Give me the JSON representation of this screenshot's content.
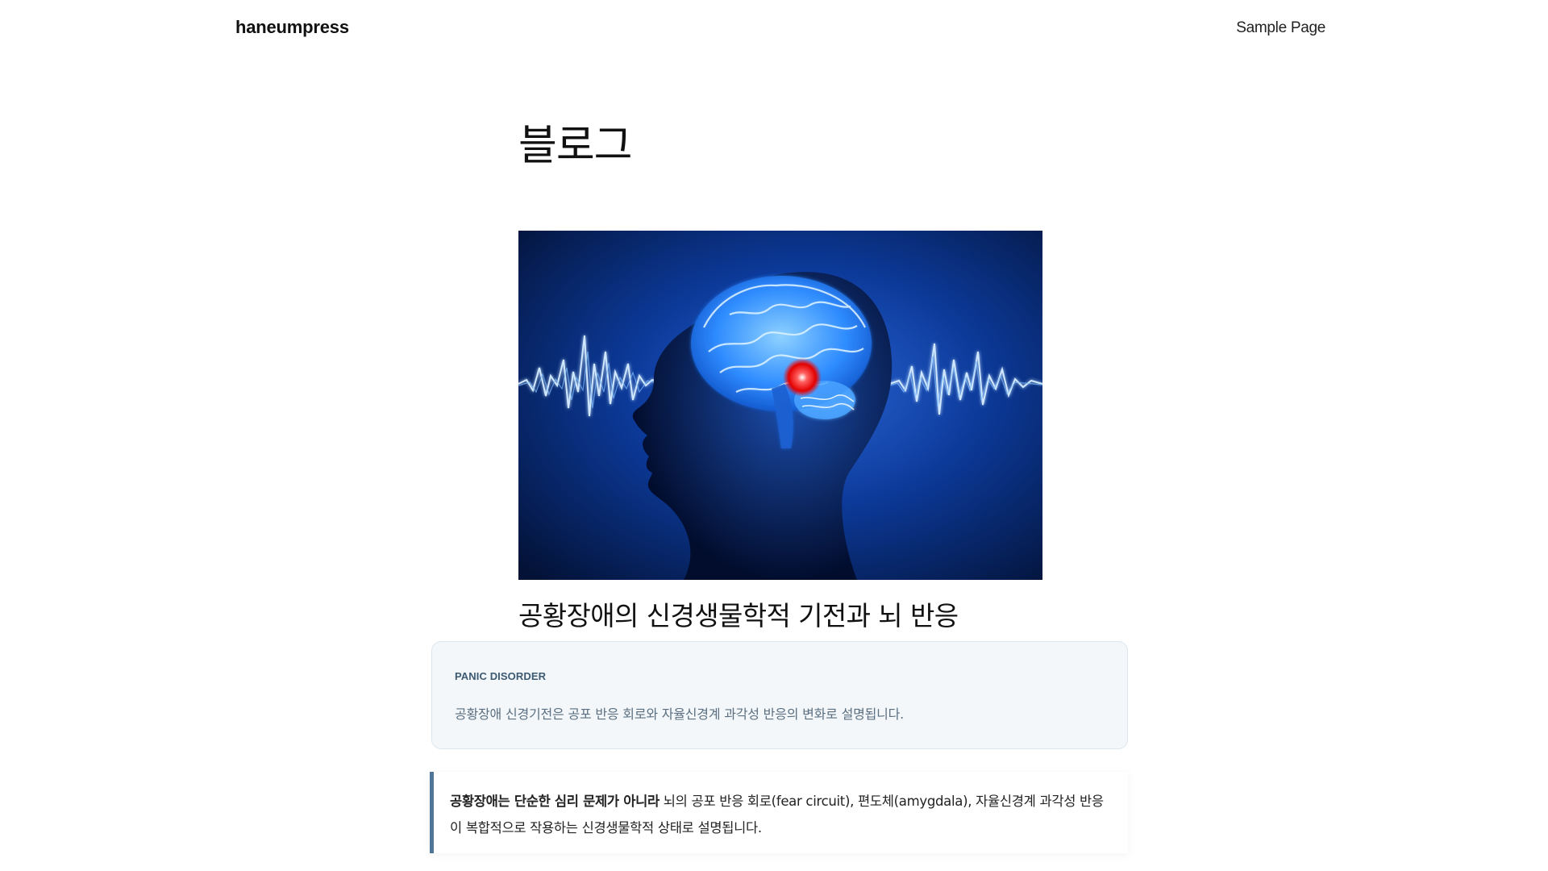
{
  "header": {
    "site_title": "haneumpress",
    "nav": [
      {
        "label": "Sample Page"
      }
    ]
  },
  "page": {
    "title": "블로그"
  },
  "post": {
    "image": {
      "icon": "brain-illustration",
      "colors": {
        "background": "#0a2a6b",
        "glow": "#2f7bff",
        "highlight": "#ff2020"
      }
    },
    "title": "공황장애의 신경생물학적 기전과 뇌 반응",
    "summary": {
      "label": "PANIC DISORDER",
      "text": "공황장애 신경기전은 공포 반응 회로와 자율신경계 과각성 반응의 변화로 설명됩니다."
    },
    "quote": {
      "bold": "공황장애는 단순한 심리 문제가 아니라",
      "text": " 뇌의 공포 반응 회로(fear circuit), 편도체(amygdala), 자율신경계 과각성 반응이 복합적으로 작용하는 신경생물학적 상태로 설명됩니다."
    }
  },
  "colors": {
    "accent": "#4f7597",
    "card_bg": "#f3f7fa",
    "label": "#3d5a73"
  }
}
